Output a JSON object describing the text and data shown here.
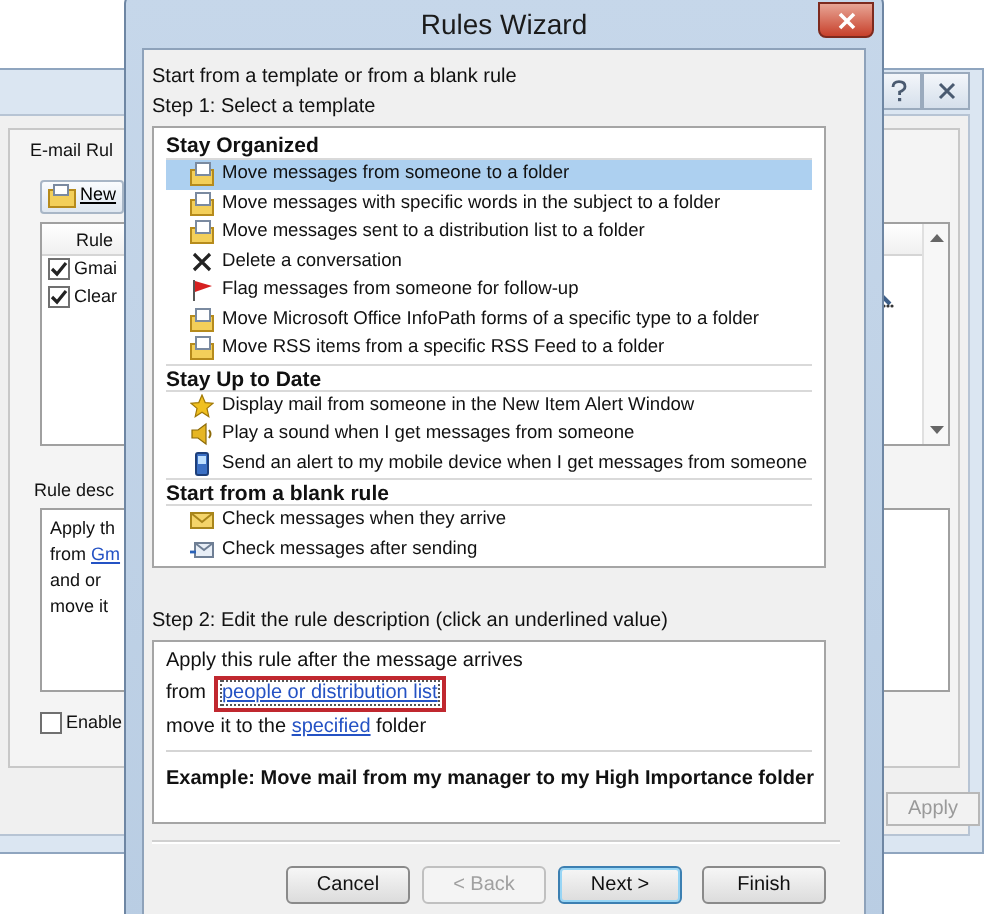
{
  "background_window": {
    "tab": "E-mail Rul",
    "new_button": "New",
    "column_header": "Rule",
    "rules": [
      {
        "name": "Gmai",
        "checked": true
      },
      {
        "name": "Clear",
        "checked": true
      }
    ],
    "description_label": "Rule desc",
    "description_lines": [
      [
        {
          "text": "Apply th"
        }
      ],
      [
        {
          "text": "from "
        },
        {
          "link": "Gm"
        }
      ],
      [
        {
          "text": " and or"
        }
      ],
      [
        {
          "text": "move it"
        }
      ]
    ],
    "enable": {
      "label": "Enable",
      "checked": false
    },
    "apply_button": {
      "label": "Apply",
      "disabled": true
    }
  },
  "dialog": {
    "title": "Rules Wizard",
    "intro": "Start from a template or from a blank rule",
    "step1": "Step 1: Select a template",
    "groups": [
      {
        "title": "Stay Organized",
        "items": [
          {
            "label": "Move messages from someone to a folder",
            "kind": "move",
            "selected": true
          },
          {
            "label": "Move messages with specific words in the subject to a folder",
            "kind": "move",
            "selected": false
          },
          {
            "label": "Move messages sent to a distribution list to a folder",
            "kind": "move",
            "selected": false
          },
          {
            "label": "Delete a conversation",
            "kind": "delete",
            "selected": false
          },
          {
            "label": "Flag messages from someone for follow-up",
            "kind": "flag",
            "selected": false
          },
          {
            "label": "Move Microsoft Office InfoPath forms of a specific type to a folder",
            "kind": "move",
            "selected": false
          },
          {
            "label": "Move RSS items from a specific RSS Feed to a folder",
            "kind": "move",
            "selected": false
          }
        ]
      },
      {
        "title": "Stay Up to Date",
        "items": [
          {
            "label": "Display mail from someone in the New Item Alert Window",
            "kind": "alert",
            "selected": false
          },
          {
            "label": "Play a sound when I get messages from someone",
            "kind": "sound",
            "selected": false
          },
          {
            "label": "Send an alert to my mobile device when I get messages from someone",
            "kind": "mobile",
            "selected": false
          }
        ]
      },
      {
        "title": "Start from a blank rule",
        "items": [
          {
            "label": "Check messages when they arrive",
            "kind": "arrive",
            "selected": false
          },
          {
            "label": "Check messages after sending",
            "kind": "send",
            "selected": false
          }
        ]
      }
    ],
    "step2": "Step 2: Edit the rule description (click an underlined value)",
    "description_lines": [
      [
        {
          "text": "Apply this rule after the message arrives"
        }
      ],
      [
        {
          "text": "from"
        },
        {
          "link": "people or distribution list",
          "highlighted": true
        }
      ],
      [
        {
          "text": "move it to the "
        },
        {
          "link": "specified",
          "highlighted": false
        },
        {
          "text": " folder"
        }
      ]
    ],
    "example": "Example: Move mail from my manager to my High Importance folder",
    "buttons": [
      {
        "label": "Cancel",
        "disabled": false,
        "default": false
      },
      {
        "label": "< Back",
        "disabled": true,
        "default": false
      },
      {
        "label": "Next >",
        "disabled": false,
        "default": true
      },
      {
        "label": "Finish",
        "disabled": false,
        "default": false
      }
    ]
  }
}
